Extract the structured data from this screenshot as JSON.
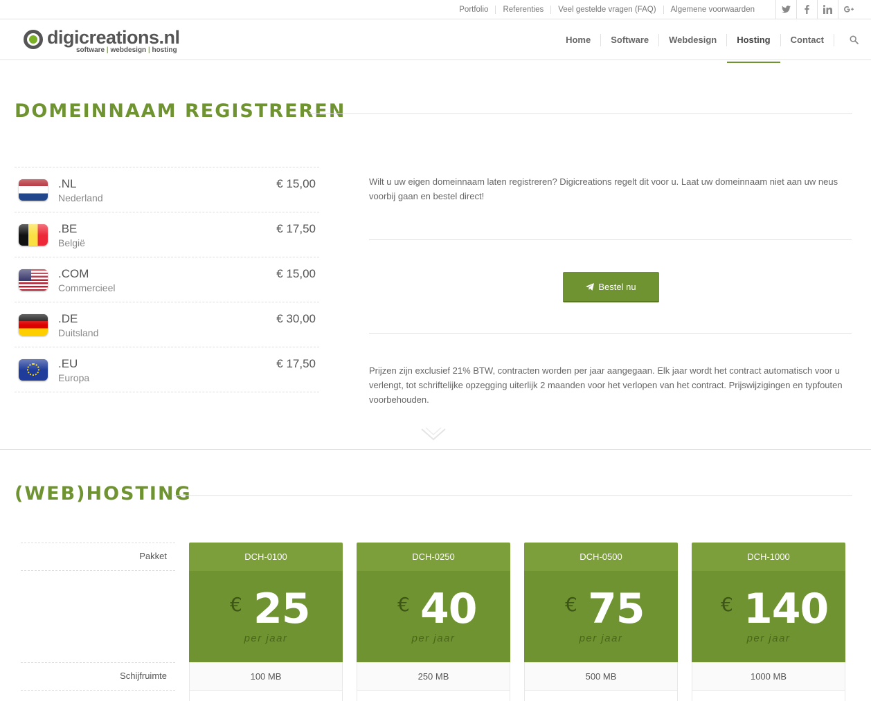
{
  "topbar": {
    "links": [
      "Portfolio",
      "Referenties",
      "Veel gestelde vragen (FAQ)",
      "Algemene voorwaarden"
    ],
    "social": [
      "twitter-icon",
      "facebook-icon",
      "linkedin-icon",
      "gplus-icon"
    ]
  },
  "header": {
    "logo_name": "digicreations.nl",
    "logo_tag": [
      "software",
      "webdesign",
      "hosting"
    ],
    "nav": [
      "Home",
      "Software",
      "Webdesign",
      "Hosting",
      "Contact"
    ],
    "active_nav": "Hosting"
  },
  "domain_section": {
    "title": "DOMEINNAAM REGISTREREN",
    "items": [
      {
        "tld": ".NL",
        "country": "Nederland",
        "price": "€ 15,00",
        "flag": "nl-flag-icon"
      },
      {
        "tld": ".BE",
        "country": "België",
        "price": "€ 17,50",
        "flag": "be-flag-icon"
      },
      {
        "tld": ".COM",
        "country": "Commercieel",
        "price": "€ 15,00",
        "flag": "us-flag-icon"
      },
      {
        "tld": ".DE",
        "country": "Duitsland",
        "price": "€ 30,00",
        "flag": "de-flag-icon"
      },
      {
        "tld": ".EU",
        "country": "Europa",
        "price": "€ 17,50",
        "flag": "eu-flag-icon"
      }
    ],
    "intro": "Wilt u uw eigen domeinnaam laten registreren? Digicreations regelt dit voor u. Laat uw domeinnaam niet aan uw neus voorbij gaan en bestel direct!",
    "button_label": "Bestel nu",
    "note": "Prijzen zijn exclusief 21% BTW, contracten worden per jaar aangegaan. Elk jaar wordt het contract automatisch voor u verlengt, tot schriftelijke opzegging uiterlijk 2 maanden voor het verlopen van het contract. Prijswijzigingen en typfouten voorbehouden."
  },
  "hosting_section": {
    "title": "(WEB)HOSTING",
    "labels": {
      "package": "Pakket",
      "storage": "Schijfruimte"
    },
    "currency": "€",
    "per": "per jaar",
    "plans": [
      {
        "name": "DCH-0100",
        "price": "25",
        "storage": "100 MB"
      },
      {
        "name": "DCH-0250",
        "price": "40",
        "storage": "250 MB"
      },
      {
        "name": "DCH-0500",
        "price": "75",
        "storage": "500 MB"
      },
      {
        "name": "DCH-1000",
        "price": "140",
        "storage": "1000 MB"
      }
    ]
  },
  "colors": {
    "accent": "#6f9330",
    "accent_light": "#7d9f3b",
    "text": "#666666"
  }
}
